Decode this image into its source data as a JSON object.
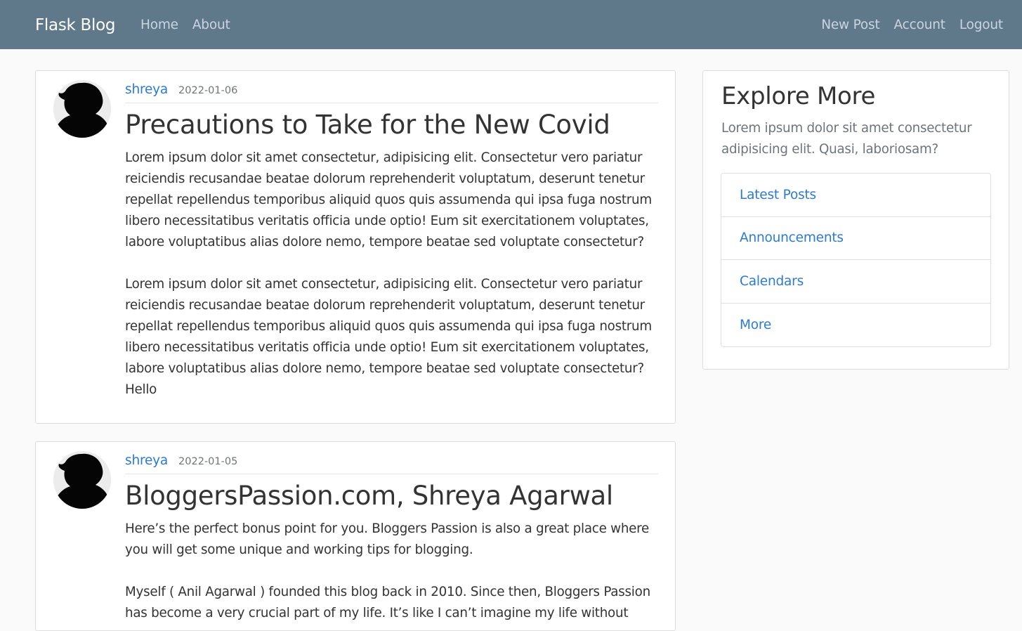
{
  "navbar": {
    "brand": "Flask Blog",
    "left_links": [
      "Home",
      "About"
    ],
    "right_links": [
      "New Post",
      "Account",
      "Logout"
    ]
  },
  "posts": [
    {
      "author": "shreya",
      "date": "2022-01-06",
      "title": "Precautions to Take for the New Covid",
      "body": "Lorem ipsum dolor sit amet consectetur, adipisicing elit. Consectetur vero pariatur reiciendis recusandae beatae dolorum reprehenderit voluptatum, deserunt tenetur repellat repellendus temporibus aliquid quos quis assumenda qui ipsa fuga nostrum libero necessitatibus veritatis officia unde optio! Eum sit exercitationem voluptates, labore voluptatibus alias dolore nemo, tempore beatae sed voluptate consectetur?\n\nLorem ipsum dolor sit amet consectetur, adipisicing elit. Consectetur vero pariatur reiciendis recusandae beatae dolorum reprehenderit voluptatum, deserunt tenetur repellat repellendus temporibus aliquid quos quis assumenda qui ipsa fuga nostrum libero necessitatibus veritatis officia unde optio! Eum sit exercitationem voluptates, labore voluptatibus alias dolore nemo, tempore beatae sed voluptate consectetur?\nHello"
    },
    {
      "author": "shreya",
      "date": "2022-01-05",
      "title": "BloggersPassion.com, Shreya Agarwal",
      "body": "Here’s the perfect bonus point for you. Bloggers Passion is also a great place where you will get some unique and working tips for blogging.\n\nMyself ( Anil Agarwal ) founded this blog back in 2010. Since then, Bloggers Passion has become a very crucial part of my life. It’s like I can’t imagine my life without"
    }
  ],
  "sidebar": {
    "title": "Explore More",
    "description": "Lorem ipsum dolor sit amet consectetur adipisicing elit. Quasi, laboriosam?",
    "items": [
      "Latest Posts",
      "Announcements",
      "Calendars",
      "More"
    ]
  },
  "colors": {
    "navbar_bg": "#5f788a",
    "link": "#2b7bd6",
    "page_bg": "#fafafa"
  }
}
